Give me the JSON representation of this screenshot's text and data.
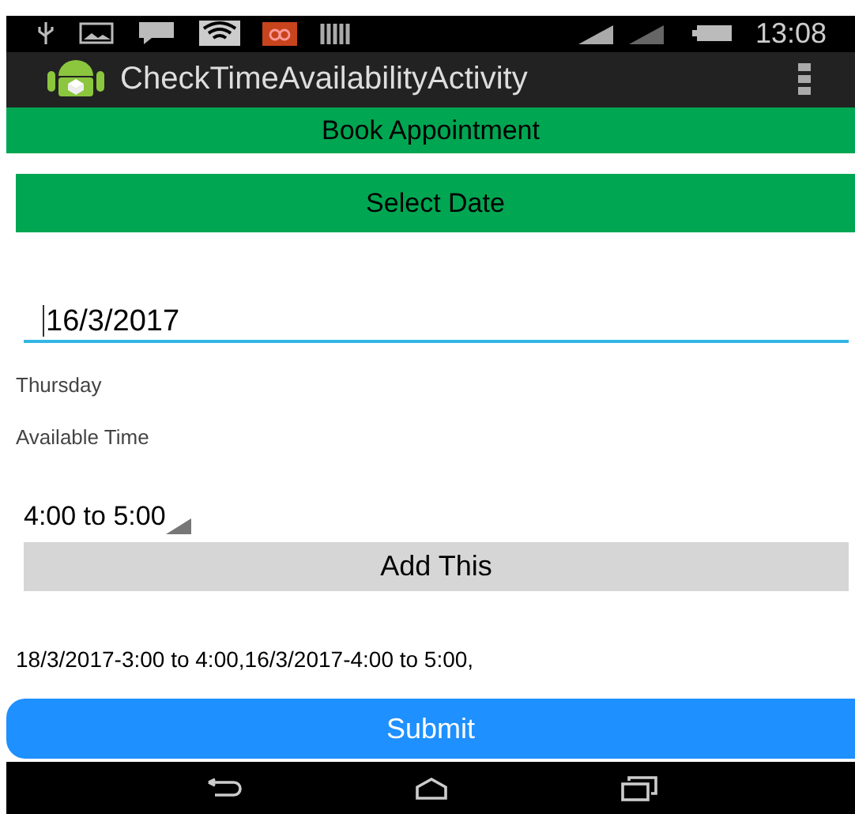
{
  "status_bar": {
    "time": "13:08"
  },
  "action_bar": {
    "title": "CheckTimeAvailabilityActivity"
  },
  "header": {
    "title": "Book Appointment"
  },
  "select_date_button": {
    "label": "Select Date"
  },
  "date_field": {
    "value": "16/3/2017"
  },
  "day_label": "Thursday",
  "available_time_label": "Available Time",
  "time_spinner": {
    "value": "4:00 to 5:00"
  },
  "add_button": {
    "label": "Add This"
  },
  "selected_slots": "18/3/2017-3:00 to 4:00,16/3/2017-4:00 to 5:00,",
  "submit_button": {
    "label": "Submit"
  }
}
